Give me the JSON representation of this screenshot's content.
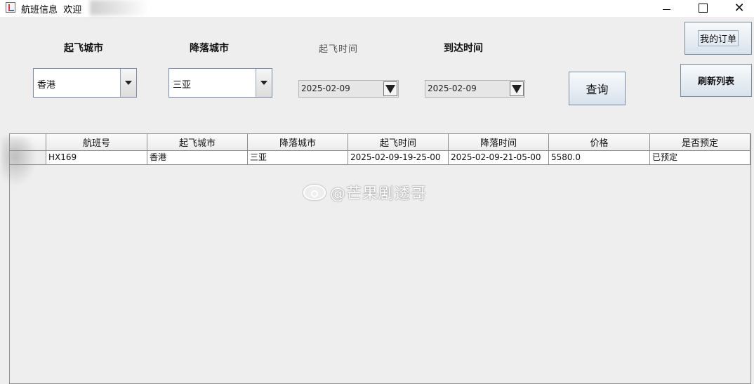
{
  "window": {
    "title": "航班信息  欢迎",
    "close_glyph": "✕"
  },
  "search": {
    "departure_city_label": "起飞城市",
    "arrival_city_label": "降落城市",
    "departure_time_label": "起飞时间",
    "arrival_time_label": "到达时间",
    "departure_city_value": "香港",
    "arrival_city_value": "三亚",
    "departure_date_value": "2025-02-09",
    "arrival_date_value": "2025-02-09",
    "query_button": "查询",
    "my_orders_button": "我的订单",
    "refresh_button": "刷新列表"
  },
  "table": {
    "columns": [
      "",
      "航班号",
      "起飞城市",
      "降落城市",
      "起飞时间",
      "降落时间",
      "价格",
      "是否预定"
    ],
    "rows": [
      [
        "",
        "HX169",
        "香港",
        "三亚",
        "2025-02-09-19-25-00",
        "2025-02-09-21-05-00",
        "5580.0",
        "已预定"
      ]
    ]
  },
  "watermark": {
    "text": "@芒果剧透哥"
  },
  "icons": {
    "app": "java-cup-icon",
    "dropdown": "triangle-down-icon"
  }
}
